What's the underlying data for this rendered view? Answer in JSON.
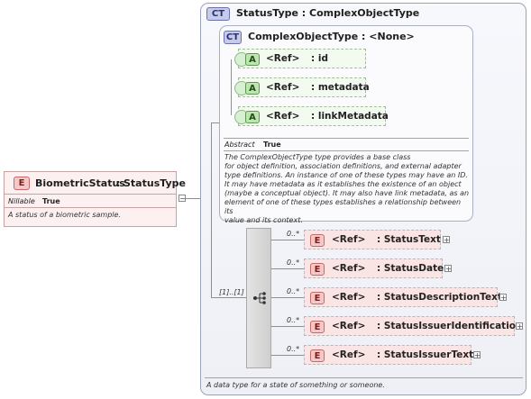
{
  "root_element": {
    "badge": "E",
    "name": "BiometricStatus",
    "type": "StatusType",
    "nillable_label": "Nillable",
    "nillable_value": "True",
    "doc": "A status of a biometric sample."
  },
  "status_type": {
    "badge": "CT",
    "title": "StatusType : ComplexObjectType",
    "doc": "A data type for a state of something or someone."
  },
  "complex_object_type": {
    "badge": "CT",
    "title": "ComplexObjectType : <None>",
    "abstract_label": "Abstract",
    "abstract_value": "True",
    "doc_lines": [
      "The ComplexObjectType type provides a base class",
      "for object definition, association definitions, and external adapter",
      "type definitions. An instance of one of these types may have an ID.",
      "It may have metadata as it establishes the existence of an object",
      "(maybe a conceptual object). It may also have link metadata, as an",
      "element of one of these types establishes a relationship between its",
      "value and its context."
    ],
    "attributes": [
      {
        "badge": "A",
        "ref": "<Ref>",
        "name": ": id"
      },
      {
        "badge": "A",
        "ref": "<Ref>",
        "name": ": metadata"
      },
      {
        "badge": "A",
        "ref": "<Ref>",
        "name": ": linkMetadata"
      }
    ]
  },
  "sequence": {
    "multiplicity": "[1]..[1]",
    "elements": [
      {
        "badge": "E",
        "ref": "<Ref>",
        "name": ": StatusText",
        "mult": "0..*"
      },
      {
        "badge": "E",
        "ref": "<Ref>",
        "name": ": StatusDate",
        "mult": "0..*"
      },
      {
        "badge": "E",
        "ref": "<Ref>",
        "name": ": StatusDescriptionText",
        "mult": "0..*"
      },
      {
        "badge": "E",
        "ref": "<Ref>",
        "name": ": StatusIssuerIdentification",
        "mult": "0..*"
      },
      {
        "badge": "E",
        "ref": "<Ref>",
        "name": ": StatusIssuerText",
        "mult": "0..*"
      }
    ]
  },
  "expander_symbol": "+",
  "collapse_symbol": "−"
}
